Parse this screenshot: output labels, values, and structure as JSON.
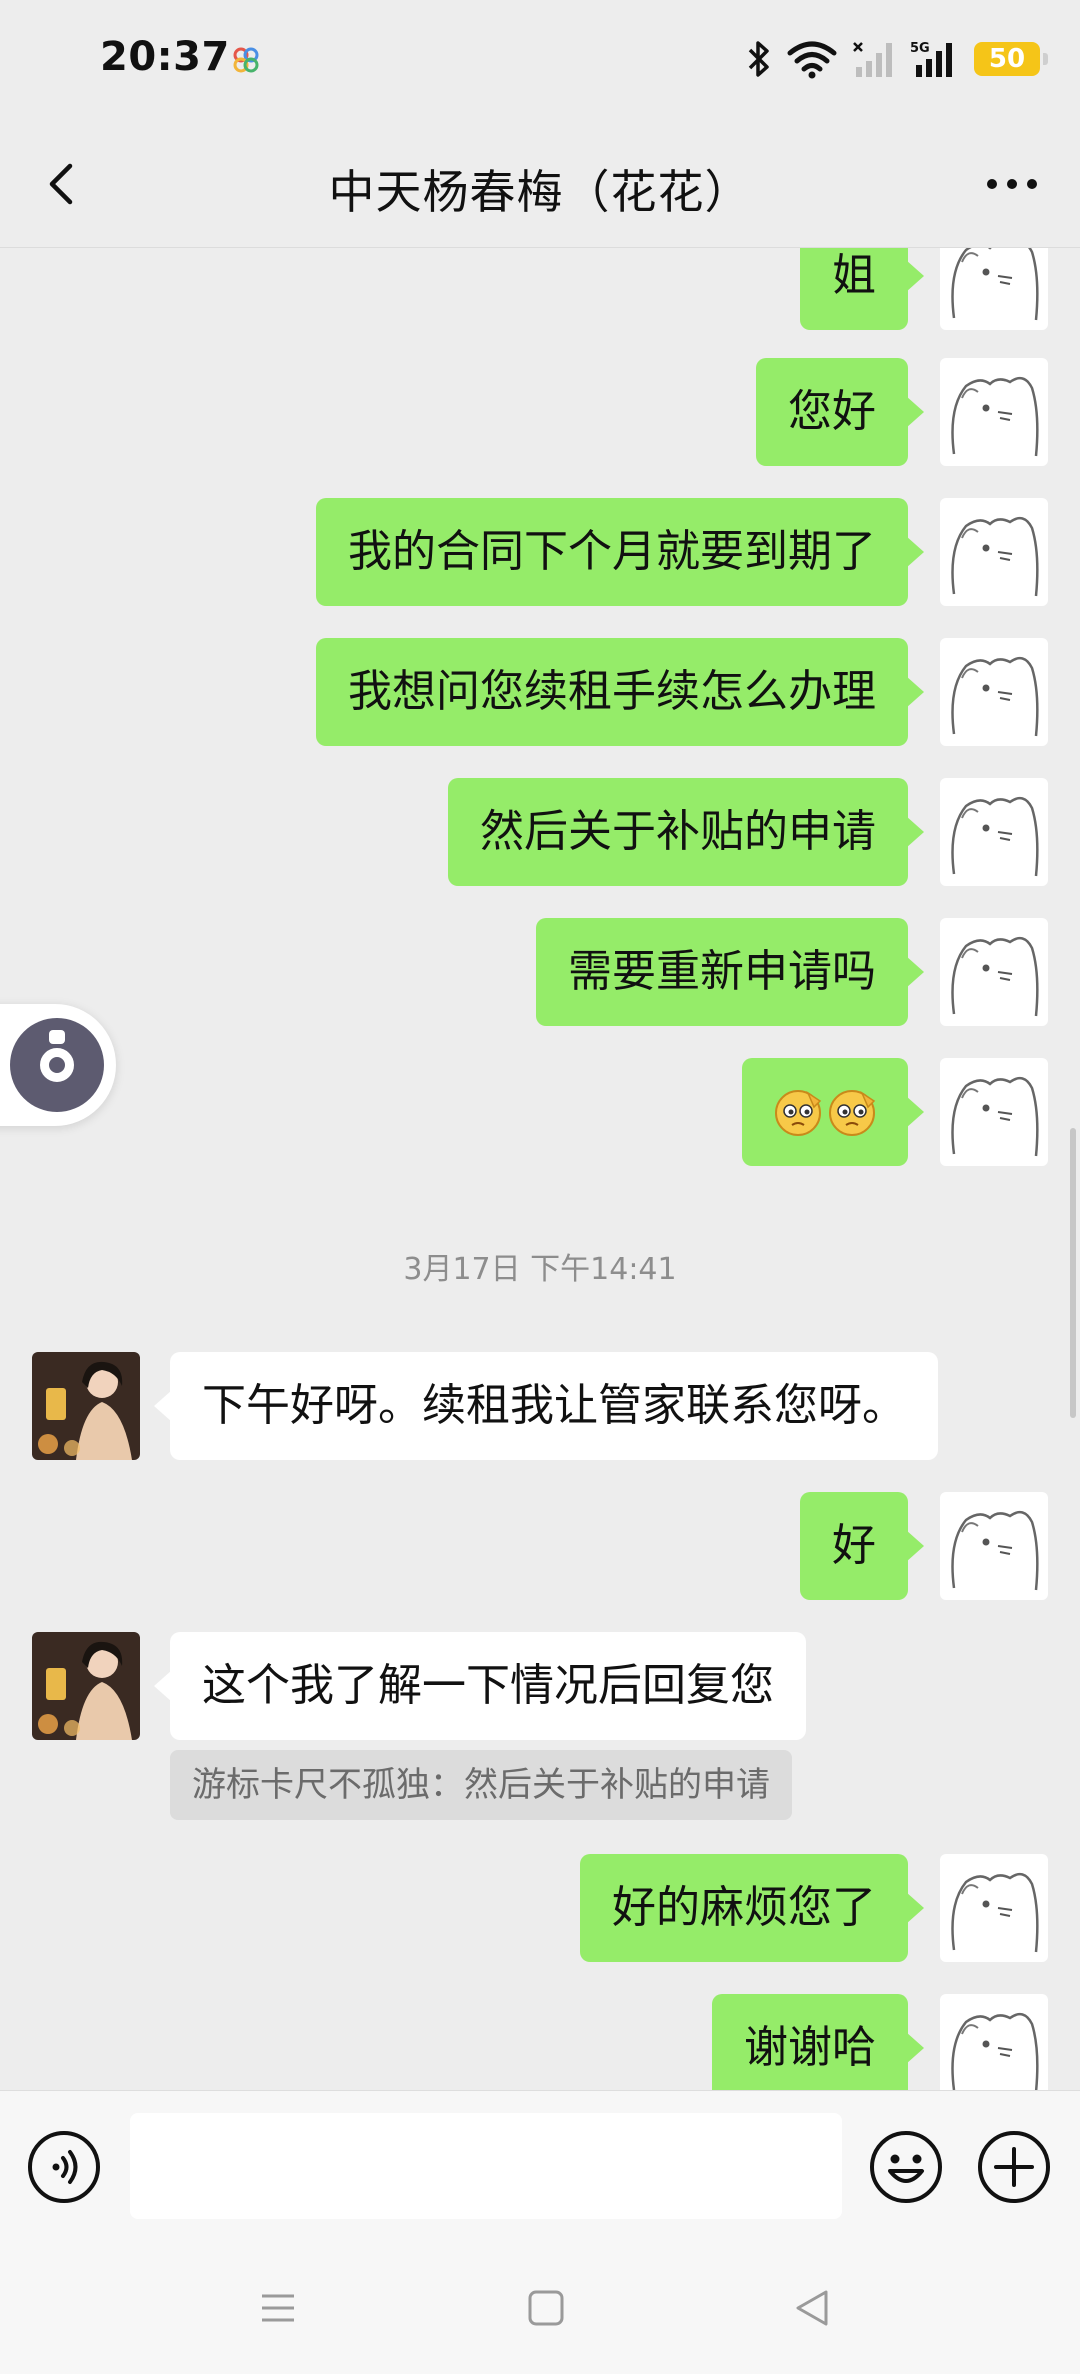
{
  "status_bar": {
    "time": "20:37",
    "battery": "50",
    "network": "5G",
    "icons": [
      "bluetooth-icon",
      "wifi-icon",
      "signal-icon",
      "battery-icon"
    ]
  },
  "header": {
    "title": "中天杨春梅（花花）",
    "back_icon": "chevron-left-icon",
    "more_icon": "more-dots-icon"
  },
  "messages": [
    {
      "side": "me",
      "text": "姐"
    },
    {
      "side": "me",
      "text": "您好"
    },
    {
      "side": "me",
      "text": "我的合同下个月就要到期了"
    },
    {
      "side": "me",
      "text": "我想问您续租手续怎么办理"
    },
    {
      "side": "me",
      "text": "然后关于补贴的申请"
    },
    {
      "side": "me",
      "text": "需要重新申请吗"
    },
    {
      "side": "me",
      "type": "emoji",
      "emoji": "salute-face-emoji x2"
    },
    {
      "type": "timestamp",
      "text": "3月17日 下午14:41"
    },
    {
      "side": "other",
      "text": "下午好呀。续租我让管家联系您呀。"
    },
    {
      "side": "me",
      "text": "好"
    },
    {
      "side": "other",
      "text": "这个我了解一下情况后回复您"
    },
    {
      "type": "quote",
      "text": "游标卡尺不孤独：然后关于补贴的申请"
    },
    {
      "side": "me",
      "text": "好的麻烦您了"
    },
    {
      "side": "me",
      "text": "谢谢哈"
    }
  ],
  "input_bar": {
    "voice_icon": "voice-icon",
    "emoji_icon": "emoji-icon",
    "plus_icon": "plus-icon",
    "value": ""
  },
  "system_nav": {
    "icons": [
      "menu-icon",
      "home-icon",
      "back-triangle-icon"
    ]
  },
  "colors": {
    "my_bubble": "#95ec69",
    "other_bubble": "#ffffff",
    "background": "#ededed",
    "battery": "#f5c518"
  }
}
